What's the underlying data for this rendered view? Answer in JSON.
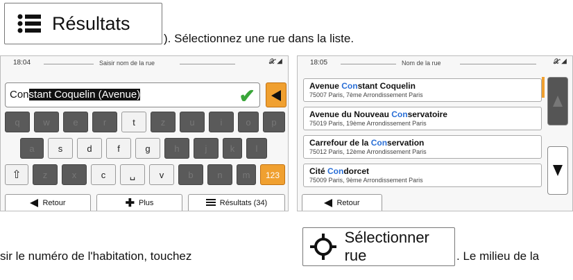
{
  "top_button": {
    "label": "Résultats",
    "icon": "list-icon"
  },
  "instruction_top": "). Sélectionnez une rue dans la liste.",
  "left_screen": {
    "time": "18:04",
    "title": "Saisir nom de la rue",
    "signal": "𝒳 ◢",
    "field": {
      "typed": "Con",
      "selected": "stant Coquelin (Avenue)"
    },
    "keys": {
      "row1": [
        "q",
        "w",
        "e",
        "r",
        "t",
        "z",
        "u",
        "i",
        "o",
        "p"
      ],
      "row2": [
        "a",
        "s",
        "d",
        "f",
        "g",
        "h",
        "j",
        "k",
        "l"
      ],
      "row3": [
        "⇧",
        "z",
        "x",
        "c",
        "␣",
        "v",
        "b",
        "n",
        "m",
        "123"
      ]
    },
    "tabs": {
      "back": "Retour",
      "more": "Plus",
      "results": "Résultats (34)"
    }
  },
  "right_screen": {
    "time": "18:05",
    "title": "Nom de la rue",
    "signal": "𝒳 ◢",
    "results": [
      {
        "pre": "Avenue ",
        "hl": "Con",
        "post": "stant Coquelin",
        "sub": "75007 Paris, 7ème Arrondissement Paris"
      },
      {
        "pre": "Avenue du Nouveau ",
        "hl": "Con",
        "post": "servatoire",
        "sub": "75019 Paris, 19ème Arrondissement Paris"
      },
      {
        "pre": "Carrefour de la ",
        "hl": "Con",
        "post": "servation",
        "sub": "75012 Paris, 12ème Arrondissement Paris"
      },
      {
        "pre": "Cité ",
        "hl": "Con",
        "post": "dorcet",
        "sub": "75009 Paris, 9ème Arrondissement Paris"
      }
    ],
    "tabs": {
      "back": "Retour"
    }
  },
  "instruction_bottom_left": "sir le numéro de l'habitation, touchez",
  "select_button": {
    "label": "Sélectionner rue",
    "icon": "crosshair-icon"
  },
  "instruction_bottom_right": ". Le milieu de la",
  "colors": {
    "accent": "#f0a030",
    "highlight": "#2a6fd6",
    "check": "#3aa63a"
  }
}
